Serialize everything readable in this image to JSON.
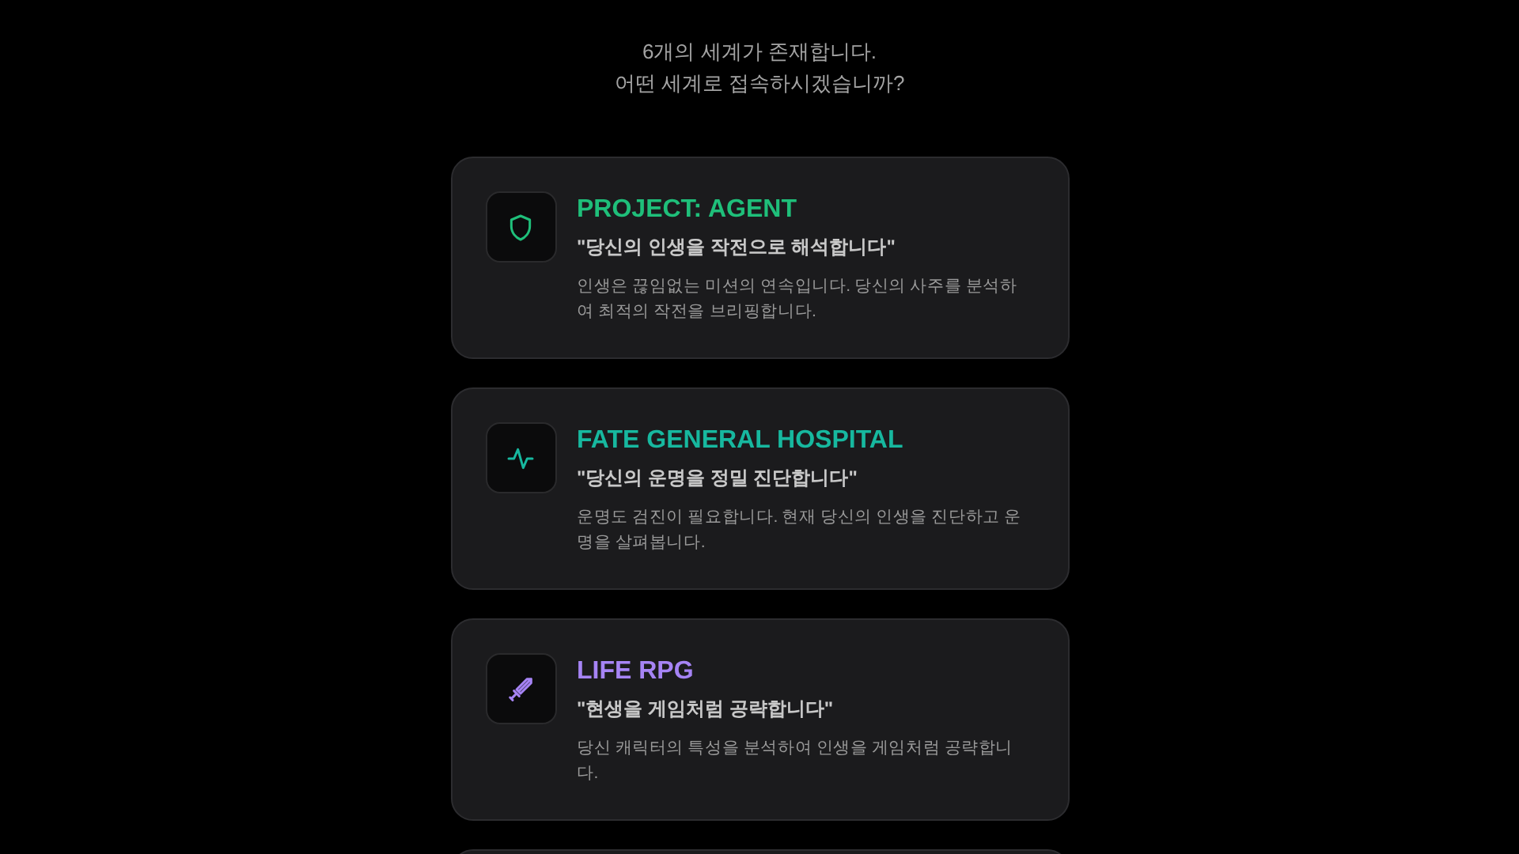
{
  "header": {
    "subtitle_lines": [
      "6개의 세계가 존재합니다.",
      "어떤 세계로 접속하시겠습니까?"
    ]
  },
  "worlds": [
    {
      "title": "PROJECT: AGENT",
      "color": "#1fbf7a",
      "tagline": "\"당신의 인생을 작전으로 해석합니다\"",
      "description": "인생은 끊임없는 미션의 연속입니다. 당신의 사주를 분석하여 최적의 작전을 브리핑합니다."
    },
    {
      "title": "FATE GENERAL HOSPITAL",
      "color": "#17b89f",
      "tagline": "\"당신의 운명을 정밀 진단합니다\"",
      "description": "운명도 검진이 필요합니다. 현재 당신의 인생을 진단하고 운명을 살펴봅니다."
    },
    {
      "title": "LIFE RPG",
      "color": "#a684f5",
      "tagline": "\"현생을 게임처럼 공략합니다\"",
      "description": "당신 캐릭터의 특성을 분석하여 인생을 게임처럼 공략합니다."
    }
  ]
}
